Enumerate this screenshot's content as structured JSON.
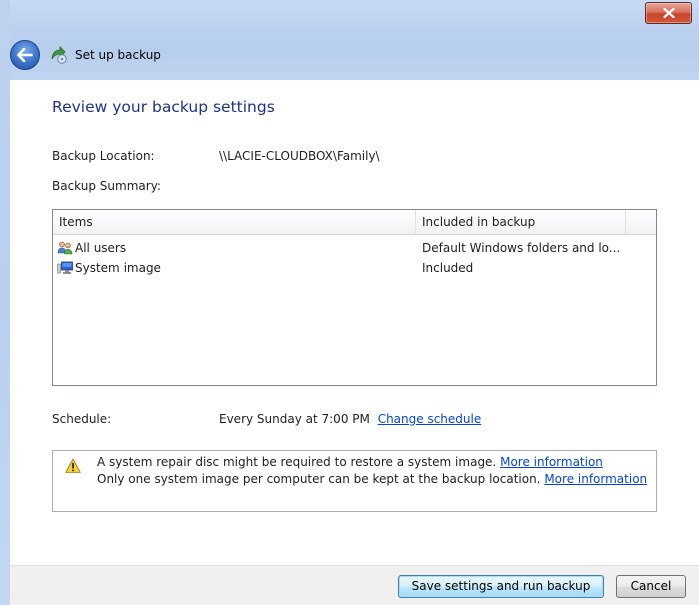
{
  "window": {
    "title": "Set up backup",
    "close_label": "×"
  },
  "page": {
    "heading": "Review your backup settings"
  },
  "fields": {
    "location_label": "Backup Location:",
    "location_value": "\\\\LACIE-CLOUDBOX\\Family\\",
    "summary_label": "Backup Summary:",
    "schedule_label": "Schedule:",
    "schedule_value": "Every Sunday at 7:00 PM",
    "change_schedule_link": "Change schedule"
  },
  "summary_table": {
    "columns": [
      "Items",
      "Included in backup",
      ""
    ],
    "rows": [
      {
        "item": "All users",
        "included": "Default Windows folders and lo...",
        "icon": "users-icon"
      },
      {
        "item": "System image",
        "included": "Included",
        "icon": "system-image-icon"
      }
    ]
  },
  "info": {
    "line1_text": "A system repair disc might be required to restore a system image.",
    "line1_link": "More information",
    "line2_text": "Only one system image per computer can be kept at the backup location.",
    "line2_link": "More information",
    "icon": "warning-icon"
  },
  "buttons": {
    "save": "Save settings and run backup",
    "cancel": "Cancel"
  },
  "colors": {
    "heading": "#1e3287",
    "link": "#0645d2",
    "titlebar": "#bdd3f0",
    "close": "#c8462b"
  }
}
